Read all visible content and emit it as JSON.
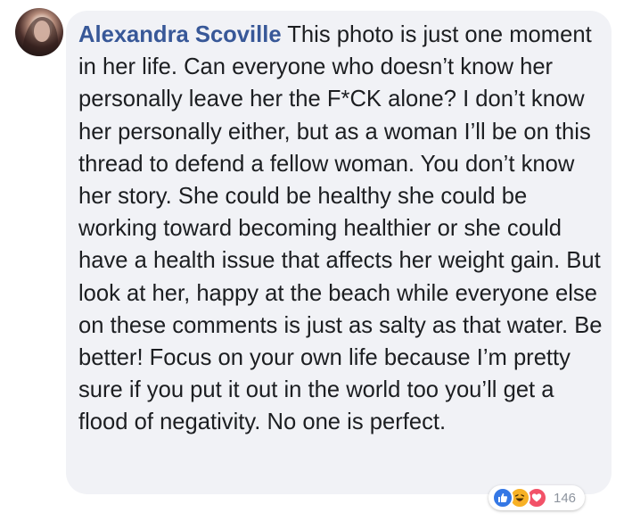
{
  "comment": {
    "author": "Alexandra Scoville",
    "text": "This photo is just one moment in her life. Can everyone who doesn’t know her personally leave her the F*CK alone? I don’t know her personally either, but as a woman I’ll be on this thread to defend a fellow woman. You don’t know her story. She could be healthy she could be working toward becoming healthier or she could have a health issue that affects her weight gain. But look at her, happy at the beach while everyone else on these comments is just as salty as that water. Be better! Focus on your own life because I’m pretty sure if you put it out in the world too you’ll get a flood of negativity. No one is perfect."
  },
  "reactions": {
    "icons": [
      "like-icon",
      "haha-icon",
      "love-icon"
    ],
    "count": "146"
  },
  "colors": {
    "author": "#385898",
    "bubble": "#f1f2f6",
    "text": "#1c1e21",
    "like": "#3578e5",
    "haha": "#f7b125",
    "love": "#f25268"
  }
}
